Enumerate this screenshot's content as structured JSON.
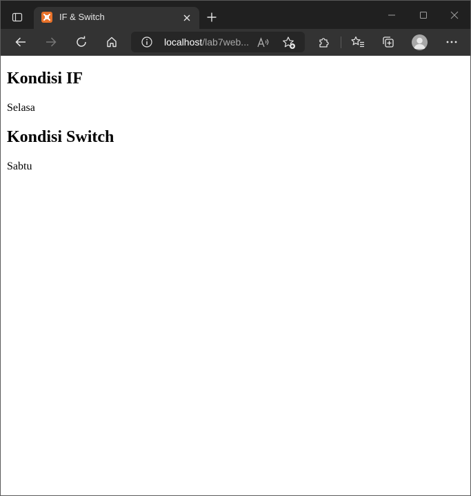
{
  "browser": {
    "tab": {
      "title": "IF & Switch",
      "favicon": "xampp-icon"
    },
    "address": {
      "host": "localhost",
      "path": "/lab7web..."
    },
    "colors": {
      "titlebar": "#202020",
      "tab_active": "#333333",
      "toolbar": "#333333",
      "addressbar": "#262626",
      "favicon": "#e8722a"
    }
  },
  "page": {
    "heading_if": "Kondisi IF",
    "result_if": "Selasa",
    "heading_switch": "Kondisi Switch",
    "result_switch": "Sabtu"
  }
}
